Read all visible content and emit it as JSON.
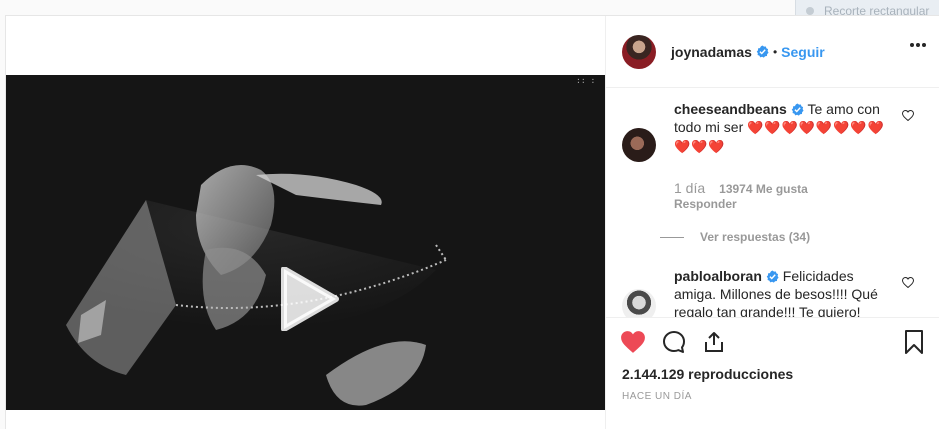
{
  "snip_toolbar": {
    "label": "Recorte rectangular"
  },
  "post": {
    "owner": {
      "username": "joynadamas",
      "follow_label": "Seguir",
      "separator": "•"
    },
    "media": {
      "type": "video"
    },
    "comments": [
      {
        "username": "cheeseandbeans",
        "text": "Te amo con todo mi ser",
        "hearts": "❤️❤️❤️❤️❤️❤️❤️❤️❤️❤️❤️",
        "time": "1 día",
        "likes": "13974 Me gusta",
        "reply_label": "Responder",
        "view_replies": "Ver respuestas (34)"
      },
      {
        "username": "pabloalboran",
        "text": "Felicidades amiga. Millones de besos!!!! Qué regalo tan grande!!! Te quiero!"
      }
    ],
    "views": "2.144.129 reproducciones",
    "posted_ago": "HACE UN DÍA"
  },
  "colors": {
    "accent": "#3897f0",
    "like_red": "#ed4956",
    "muted": "#999999"
  }
}
